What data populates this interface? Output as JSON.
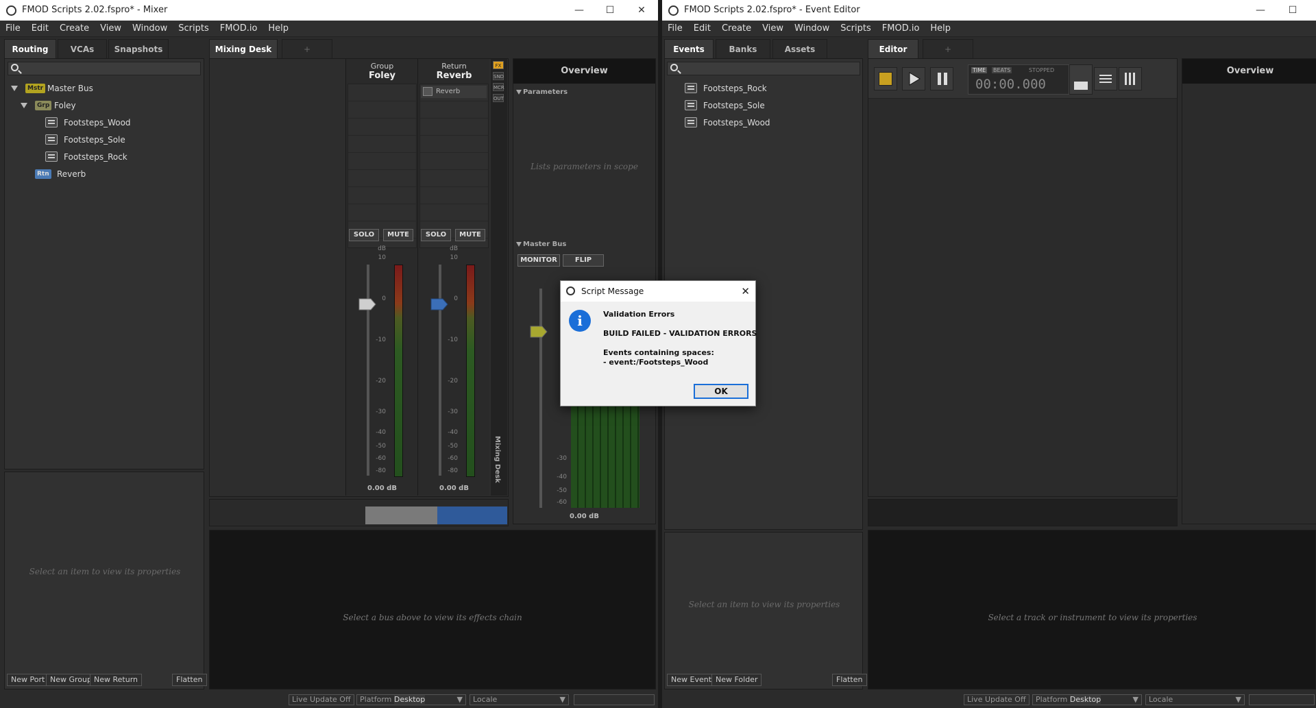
{
  "mixer_window": {
    "title": "FMOD Scripts 2.02.fspro* - Mixer",
    "controls": {
      "minimize": "—",
      "maximize": "☐",
      "close": "✕"
    },
    "menu": [
      "File",
      "Edit",
      "Create",
      "View",
      "Window",
      "Scripts",
      "FMOD.io",
      "Help"
    ],
    "left_tabs": [
      "Routing",
      "VCAs",
      "Snapshots"
    ],
    "center_tabs": [
      "Mixing Desk",
      "+"
    ],
    "tree": {
      "master_badge": "Mstr",
      "master_label": "Master Bus",
      "group_badge": "Grp",
      "group_label": "Foley",
      "events": [
        "Footsteps_Wood",
        "Footsteps_Sole",
        "Footsteps_Rock"
      ],
      "return_badge": "Rtn",
      "return_label": "Reverb"
    },
    "properties_hint": "Select an item to view its properties",
    "bottom_buttons": {
      "new_port": "New Port",
      "new_group": "New Group",
      "new_return": "New Return",
      "flatten": "Flatten"
    },
    "strips": {
      "foley": {
        "type": "Group",
        "name": "Foley",
        "solo": "SOLO",
        "mute": "MUTE",
        "db_unit": "dB",
        "value": "0.00 dB"
      },
      "reverb": {
        "type": "Return",
        "name": "Reverb",
        "effect": "Reverb",
        "solo": "SOLO",
        "mute": "MUTE",
        "db_unit": "dB",
        "value": "0.00 dB"
      },
      "scale": [
        "10",
        "0",
        "-10",
        "-20",
        "-30",
        "-40",
        "-50",
        "-60",
        "-80"
      ]
    },
    "fx_tabs": [
      "FX",
      "SND",
      "MCR",
      "OUT"
    ],
    "mixing_desk_label": "Mixing Desk",
    "overview": {
      "title": "Overview",
      "parameters_header": "Parameters",
      "parameters_hint": "Lists parameters in scope",
      "master_bus_header": "Master Bus",
      "monitor": "MONITOR",
      "flip": "FLIP",
      "value": "0.00 dB"
    },
    "effects_hint": "Select a bus above to view its effects chain",
    "status": {
      "live_update": "Live Update Off",
      "platform_label": "Platform",
      "platform_value": "Desktop",
      "locale_label": "Locale",
      "locale_value": ""
    }
  },
  "event_window": {
    "title": "FMOD Scripts 2.02.fspro* - Event Editor",
    "controls": {
      "minimize": "—",
      "maximize": "☐"
    },
    "menu": [
      "File",
      "Edit",
      "Create",
      "View",
      "Window",
      "Scripts",
      "FMOD.io",
      "Help"
    ],
    "left_tabs": [
      "Events",
      "Banks",
      "Assets"
    ],
    "center_tabs": [
      "Editor",
      "+"
    ],
    "events": [
      "Footsteps_Rock",
      "Footsteps_Sole",
      "Footsteps_Wood"
    ],
    "transport": {
      "time": "TIME",
      "beats": "BEATS",
      "state": "STOPPED",
      "timecode": "00:00.000"
    },
    "overview_title": "Overview",
    "properties_hint": "Select an item to view its properties",
    "track_hint": "Select a track or instrument to view its properties",
    "bottom_buttons": {
      "new_event": "New Event",
      "new_folder": "New Folder",
      "flatten": "Flatten"
    },
    "status": {
      "live_update": "Live Update Off",
      "platform_label": "Platform",
      "platform_value": "Desktop",
      "locale_label": "Locale",
      "locale_value": ""
    }
  },
  "dialog": {
    "title": "Script Message",
    "close": "✕",
    "icon": "i",
    "heading": "Validation Errors",
    "line1": "BUILD FAILED - VALIDATION ERRORS",
    "line2": "Events containing spaces:",
    "line3": "- event:/Footsteps_Wood",
    "ok": "OK"
  }
}
